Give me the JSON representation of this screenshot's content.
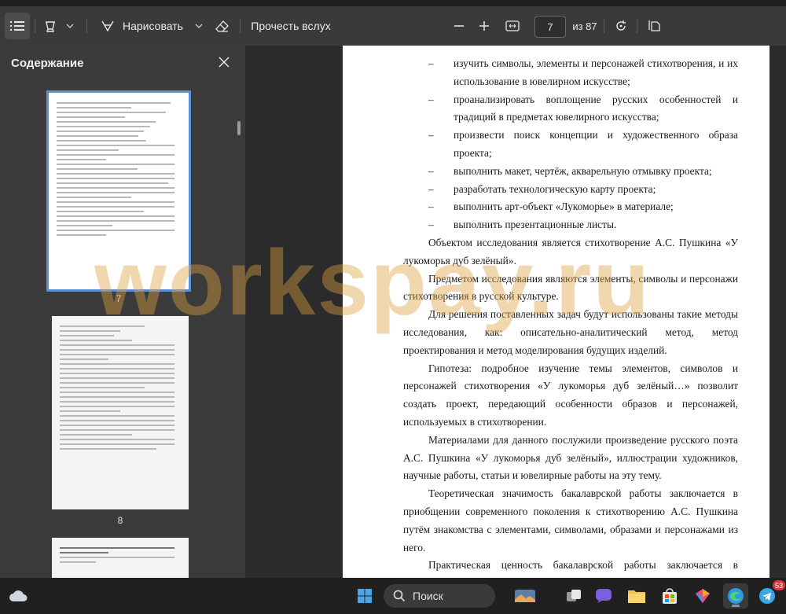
{
  "toolbar": {
    "draw_label": "Нарисовать",
    "read_aloud_label": "Прочесть вслух",
    "page_current": "7",
    "page_total": "из 87"
  },
  "sidebar": {
    "title": "Содержание",
    "thumbs": [
      {
        "number": "7",
        "selected": true
      },
      {
        "number": "8",
        "selected": false
      },
      {
        "number": "",
        "selected": false
      }
    ]
  },
  "document": {
    "dash_items": [
      "изучить символы, элементы и персонажей стихотворения, и их использование в ювелирном искусстве;",
      "проанализировать воплощение русских особенностей и традиций в предметах ювелирного искусства;",
      "произвести поиск концепции и художественного образа проекта;",
      "выполнить макет, чертёж, акварельную отмывку проекта;",
      "разработать технологическую карту проекта;",
      "выполнить арт-объект «Лукоморье» в материале;",
      "выполнить презентационные листы."
    ],
    "paragraphs": [
      "Объектом исследования является стихотворение А.С. Пушкина «У лукоморья дуб зелёный».",
      "Предметом исследования являются элементы, символы и персонажи стихотворения в русской культуре.",
      "Для решения поставленных задач будут использованы такие методы исследования, как: описательно-аналитический метод, метод проектирования и метод моделирования будущих изделий.",
      "Гипотеза: подробное изучение темы элементов, символов и персонажей стихотворения «У лукоморья дуб зелёный…» позволит создать проект, передающий особенности образов и персонажей, используемых в стихотворении.",
      "Материалами для данного послужили произведение русского поэта А.С. Пушкина «У лукоморья дуб зелёный», иллюстрации художников, научные работы, статьи и ювелирные работы на эту тему.",
      "Теоретическая значимость бакалаврской работы заключается в приобщении современного поколения к стихотворению А.С. Пушкина путём знакомства с элементами, символами, образами и персонажами из него.",
      "Практическая ценность бакалаврской работы заключается в разработке проекта арт-объекта «Лукоморье»."
    ],
    "watermark": "workspay.ru"
  },
  "taskbar": {
    "search_label": "Поиск",
    "badge_count": "53"
  }
}
